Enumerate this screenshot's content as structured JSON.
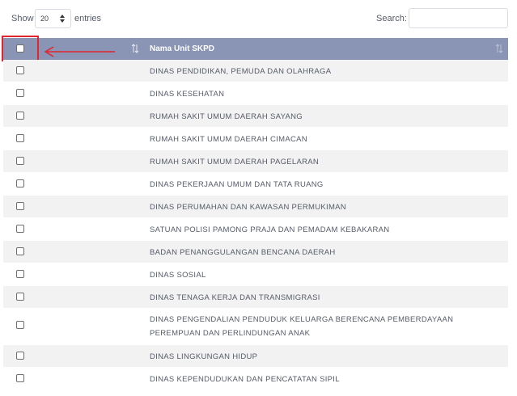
{
  "toolbar": {
    "show_label": "Show",
    "page_length": "20",
    "entries_label": "entries",
    "search_label": "Search:",
    "search_value": ""
  },
  "table": {
    "header": {
      "name_column": "Nama Unit SKPD",
      "sort_icon": "sort-arrows-icon"
    },
    "rows": [
      {
        "name": "DINAS PENDIDIKAN, PEMUDA DAN OLAHRAGA"
      },
      {
        "name": "DINAS KESEHATAN"
      },
      {
        "name": "RUMAH SAKIT UMUM DAERAH SAYANG"
      },
      {
        "name": "RUMAH SAKIT UMUM DAERAH CIMACAN"
      },
      {
        "name": "RUMAH SAKIT UMUM DAERAH PAGELARAN"
      },
      {
        "name": "DINAS PEKERJAAN UMUM DAN TATA RUANG"
      },
      {
        "name": "DINAS PERUMAHAN DAN KAWASAN PERMUKIMAN"
      },
      {
        "name": "SATUAN POLISI PAMONG PRAJA DAN PEMADAM KEBAKARAN"
      },
      {
        "name": "BADAN PENANGGULANGAN BENCANA DAERAH"
      },
      {
        "name": "DINAS SOSIAL"
      },
      {
        "name": "DINAS TENAGA KERJA DAN TRANSMIGRASI"
      },
      {
        "name": "DINAS PENGENDALIAN PENDUDUK KELUARGA BERENCANA PEMBERDAYAAN PEREMPUAN DAN PERLINDUNGAN ANAK"
      },
      {
        "name": "DINAS LINGKUNGAN HIDUP"
      },
      {
        "name": "DINAS KEPENDUDUKAN DAN PENCATATAN SIPIL"
      }
    ]
  },
  "colors": {
    "header_bg": "#8a94b4",
    "stripe": "#f2f2f2",
    "annotation": "#e0252d"
  }
}
